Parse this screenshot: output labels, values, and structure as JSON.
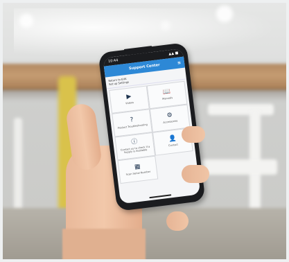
{
  "status_bar": {
    "time": "10:44",
    "signal": "▲▲ ■"
  },
  "app_header": {
    "title": "Support Center",
    "menu_icon": "menu-icon"
  },
  "welcome": {
    "line1": "Return to EVK",
    "line2": "Set up Settings"
  },
  "tiles": [
    {
      "icon": "video-icon",
      "glyph": "▶",
      "label": "Videos"
    },
    {
      "icon": "manual-icon",
      "glyph": "📖",
      "label": "Manuals"
    },
    {
      "icon": "help-icon",
      "glyph": "?",
      "label": "Product Troubleshooting"
    },
    {
      "icon": "parts-icon",
      "glyph": "⚙",
      "label": "Accessories"
    },
    {
      "icon": "info-icon",
      "glyph": "ⓘ",
      "label": "Contact us to check if a Supply is Available"
    },
    {
      "icon": "person-icon",
      "glyph": "👤",
      "label": "Contact"
    },
    {
      "icon": "qr-icon",
      "glyph": "▦",
      "label": "Scan Serial Number"
    }
  ],
  "colors": {
    "accent": "#2d88d6",
    "phone_body": "#1b1c1f"
  }
}
